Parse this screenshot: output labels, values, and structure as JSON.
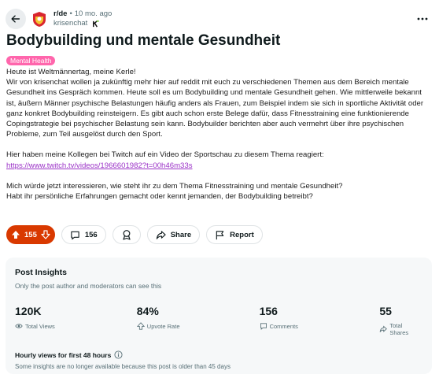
{
  "post": {
    "subreddit": "r/de",
    "separator": "•",
    "time": "10 mo. ago",
    "author": "krisenchat",
    "title": "Bodybuilding und mentale Gesundheit",
    "flair": "Mental Health",
    "flair_color": "#ff66ac",
    "paragraphs": [
      "Heute ist Weltmännertag, meine Kerle!",
      "Wir von krisenchat wollen ja zukünftig mehr hier auf reddit mit euch zu verschiedenen Themen aus dem Bereich mentale Gesundheit ins Gespräch kommen. Heute soll es um Bodybuilding und mentale Gesundheit gehen. Wie mittlerweile bekannt ist, äußern Männer psychische Belastungen häufig anders als Frauen, zum Beispiel indem sie sich in sportliche Aktivität oder ganz konkret Bodybuilding reinsteigern. Es gibt auch schon erste Belege dafür, dass Fitnesstraining eine funktionierende Copingstrategie bei psychischer Belastung sein kann. Bodybuilder berichten aber auch vermehrt über ihre psychischen Probleme, zum Teil ausgelöst durch den Sport.",
      "Hier haben meine Kollegen bei Twitch auf ein Video der Sportschau zu diesem Thema reagiert:",
      "https://www.twitch.tv/videos/1966601982?t=00h46m33s",
      "Mich würde jetzt interessieren, wie steht ihr zu dem Thema Fitnesstraining und mentale Gesundheit?",
      "Habt ihr persönliche Erfahrungen gemacht oder kennt jemanden, der Bodybuilding betreibt?"
    ]
  },
  "actions": {
    "votes": "155",
    "comments": "156",
    "share": "Share",
    "report": "Report",
    "vote_color": "#d93900"
  },
  "insights": {
    "title": "Post Insights",
    "subtitle": "Only the post author and moderators can see this",
    "stats": [
      {
        "value": "120K",
        "label": "Total Views",
        "icon": "eye-icon"
      },
      {
        "value": "84%",
        "label": "Upvote Rate",
        "icon": "upvote-icon"
      },
      {
        "value": "156",
        "label": "Comments",
        "icon": "comment-icon"
      },
      {
        "value": "55",
        "label": "Total Shares",
        "icon": "share-icon"
      }
    ],
    "hourly_title": "Hourly views for first 48 hours",
    "hourly_note": "Some insights are no longer available because this post is older than 45 days"
  }
}
